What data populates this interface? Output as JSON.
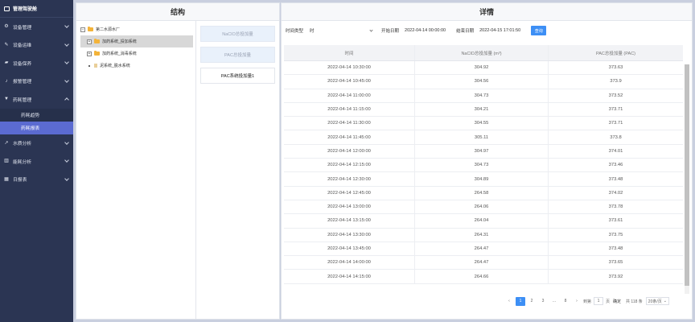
{
  "sidebar": {
    "title": "管理驾驶舱",
    "items": [
      {
        "label": "设备管理",
        "icon": "gear-icon"
      },
      {
        "label": "设备运维",
        "icon": "wrench-icon"
      },
      {
        "label": "设备保养",
        "icon": "car-icon"
      },
      {
        "label": "报警管理",
        "icon": "bell-icon"
      },
      {
        "label": "药耗管理",
        "icon": "filter-icon"
      }
    ],
    "subitems": [
      "药耗趋势",
      "药耗报表"
    ],
    "items_after": [
      {
        "label": "水质分析",
        "icon": "line-chart-icon"
      },
      {
        "label": "能耗分析",
        "icon": "bar-chart-icon"
      },
      {
        "label": "日报表",
        "icon": "calendar-icon"
      }
    ]
  },
  "structure": {
    "title": "结构",
    "tree": {
      "root": "第二水源水厂",
      "children": [
        "加药系统_投加系统",
        "加药系统_消毒系统",
        "泥系统_脱水系统"
      ]
    },
    "types": [
      "NaClO总投加量",
      "PAC总投加量",
      "PAC系统投加量1"
    ]
  },
  "detail": {
    "title": "详情",
    "filter": {
      "time_type_label": "时间类型",
      "time_type_value": "时",
      "start_label": "开始日期",
      "start_value": "2022-04-14 00:00:00",
      "end_label": "结束日期",
      "end_value": "2022-04-15 17:01:50",
      "query_button": "查询"
    },
    "columns": [
      "时间",
      "NaClO总投加量 (m³)",
      "PAC总投加量 (PAC)"
    ],
    "rows": [
      [
        "2022-04-14 10:30:00",
        "304.92",
        "373.63"
      ],
      [
        "2022-04-14 10:45:00",
        "304.56",
        "373.9"
      ],
      [
        "2022-04-14 11:00:00",
        "304.73",
        "373.52"
      ],
      [
        "2022-04-14 11:15:00",
        "304.21",
        "373.71"
      ],
      [
        "2022-04-14 11:30:00",
        "304.55",
        "373.71"
      ],
      [
        "2022-04-14 11:45:00",
        "305.11",
        "373.8"
      ],
      [
        "2022-04-14 12:00:00",
        "304.97",
        "374.01"
      ],
      [
        "2022-04-14 12:15:00",
        "304.73",
        "373.46"
      ],
      [
        "2022-04-14 12:30:00",
        "304.89",
        "373.48"
      ],
      [
        "2022-04-14 12:45:00",
        "264.58",
        "374.02"
      ],
      [
        "2022-04-14 13:00:00",
        "264.06",
        "373.78"
      ],
      [
        "2022-04-14 13:15:00",
        "264.04",
        "373.61"
      ],
      [
        "2022-04-14 13:30:00",
        "264.31",
        "373.75"
      ],
      [
        "2022-04-14 13:45:00",
        "264.47",
        "373.48"
      ],
      [
        "2022-04-14 14:00:00",
        "264.47",
        "373.65"
      ],
      [
        "2022-04-14 14:15:00",
        "264.66",
        "373.92"
      ]
    ],
    "pagination": {
      "pages": [
        "1",
        "2",
        "3",
        "...",
        "8"
      ],
      "goto_label": "到第",
      "goto_value": "1",
      "page_unit": "页",
      "confirm": "确定",
      "total": "共 118 条",
      "page_size": "20条/页"
    }
  }
}
